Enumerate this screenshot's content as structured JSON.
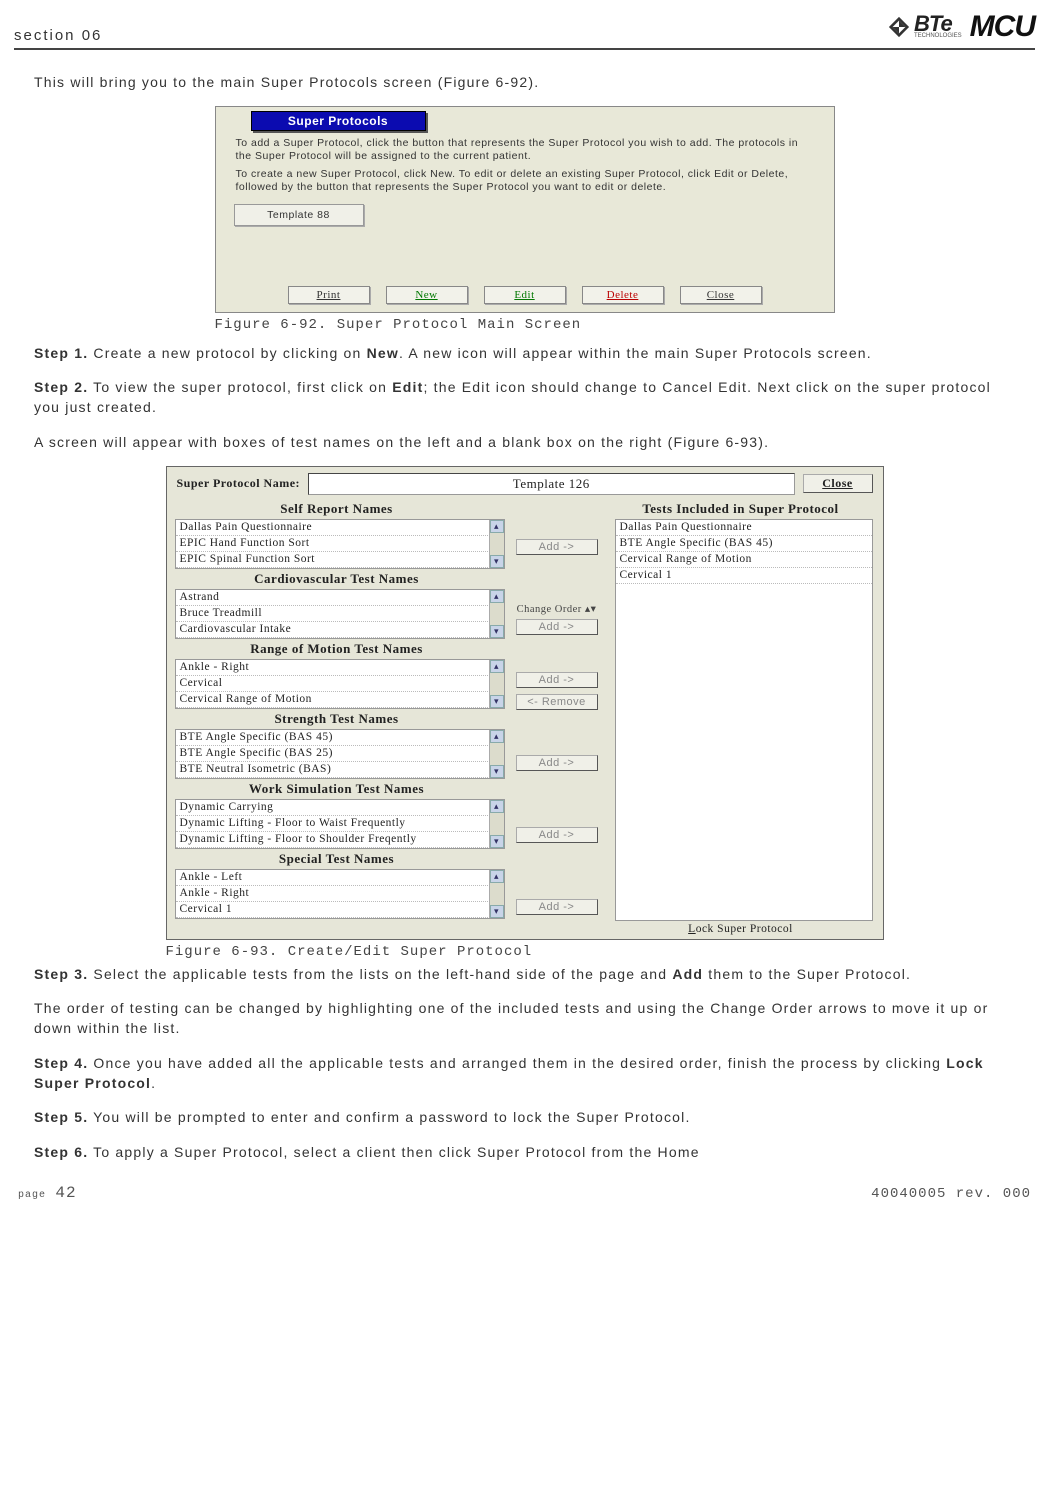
{
  "header": {
    "section": "section 06",
    "bte": "BTe",
    "bte_sub": "TECHNOLOGIES",
    "mcu": "MCU"
  },
  "intro": "This will bring you to the main Super Protocols screen (Figure 6-92).",
  "fig92": {
    "banner": "Super Protocols",
    "txt1": "To add a Super Protocol, click the button that represents the Super Protocol you wish to add. The protocols in the Super Protocol will be assigned to the current patient.",
    "txt2": "To create a new Super Protocol, click New. To edit or delete an existing Super Protocol, click Edit or Delete, followed by the button that represents the Super Protocol you want to edit or delete.",
    "template": "Template 88",
    "buttons": {
      "print": "Print",
      "new": "New",
      "edit": "Edit",
      "delete": "Delete",
      "close": "Close"
    },
    "caption": "Figure 6-92. Super Protocol Main Screen"
  },
  "step1_a": "Step 1.",
  "step1_b": " Create a new protocol by clicking on ",
  "step1_c": "New",
  "step1_d": ". A new icon will appear within the main Super Protocols screen.",
  "step2_a": "Step 2.",
  "step2_b": " To view the super protocol, first click on ",
  "step2_c": "Edit",
  "step2_d": "; the Edit icon should change to Cancel Edit. Next click on the super protocol you just created.",
  "para_after2": "A screen will appear with boxes of test names on the left and a blank box on the right (Figure 6-93).",
  "fig93": {
    "name_label": "Super Protocol Name:",
    "name_value": "Template 126",
    "close": "Close",
    "left_head": "Self Report Names",
    "right_head": "Tests Included in Super Protocol",
    "self_report": [
      "Dallas Pain Questionnaire",
      "EPIC Hand Function Sort",
      "EPIC Spinal Function Sort"
    ],
    "cardio_head": "Cardiovascular Test Names",
    "cardio": [
      "Astrand",
      "Bruce Treadmill",
      "Cardiovascular Intake"
    ],
    "rom_head": "Range of Motion Test Names",
    "rom": [
      "Ankle - Right",
      "Cervical",
      "Cervical Range of Motion"
    ],
    "str_head": "Strength Test Names",
    "str": [
      "BTE  Angle Specific (BAS 45)",
      "BTE Angle Specific (BAS 25)",
      "BTE Neutral Isometric (BAS)"
    ],
    "ws_head": "Work Simulation Test Names",
    "ws": [
      "Dynamic Carrying",
      "Dynamic Lifting -  Floor to Waist Frequently",
      "Dynamic Lifting - Floor to Shoulder Freqently"
    ],
    "sp_head": "Special Test Names",
    "sp": [
      "Ankle - Left",
      "Ankle - Right",
      "Cervical 1"
    ],
    "included": [
      "Dallas Pain Questionnaire",
      "BTE  Angle Specific (BAS 45)",
      "Cervical Range of Motion",
      "Cervical 1"
    ],
    "add": "Add ->",
    "add_s": "Add  ->",
    "remove": "<- Remove",
    "change": "Change Order",
    "lock_l": "L",
    "lock_r": "ock Super Protocol",
    "caption": "Figure 6-93. Create/Edit Super Protocol"
  },
  "step3_a": "Step 3.",
  "step3_b": " Select the applicable tests from the lists on the left-hand side of the page and ",
  "step3_c": "Add",
  "step3_d": " them to the Super Protocol.",
  "para_after3": "The order of testing can be changed by highlighting one of the included tests and using the Change Order arrows to move it up or down within the list.",
  "step4_a": "Step 4.",
  "step4_b": " Once you have added all the applicable tests and arranged them in the desired order, finish the process by clicking ",
  "step4_c": "Lock Super Protocol",
  "step4_d": ".",
  "step5_a": "Step 5.",
  "step5_b": " You will be prompted to enter and confirm a password to lock the Super Protocol.",
  "step6_a": "Step 6.",
  "step6_b": " To apply a Super Protocol, select a client then click Super Protocol from the Home",
  "footer": {
    "page_label": "page",
    "page_num": "42",
    "rev": "40040005 rev. 000"
  }
}
